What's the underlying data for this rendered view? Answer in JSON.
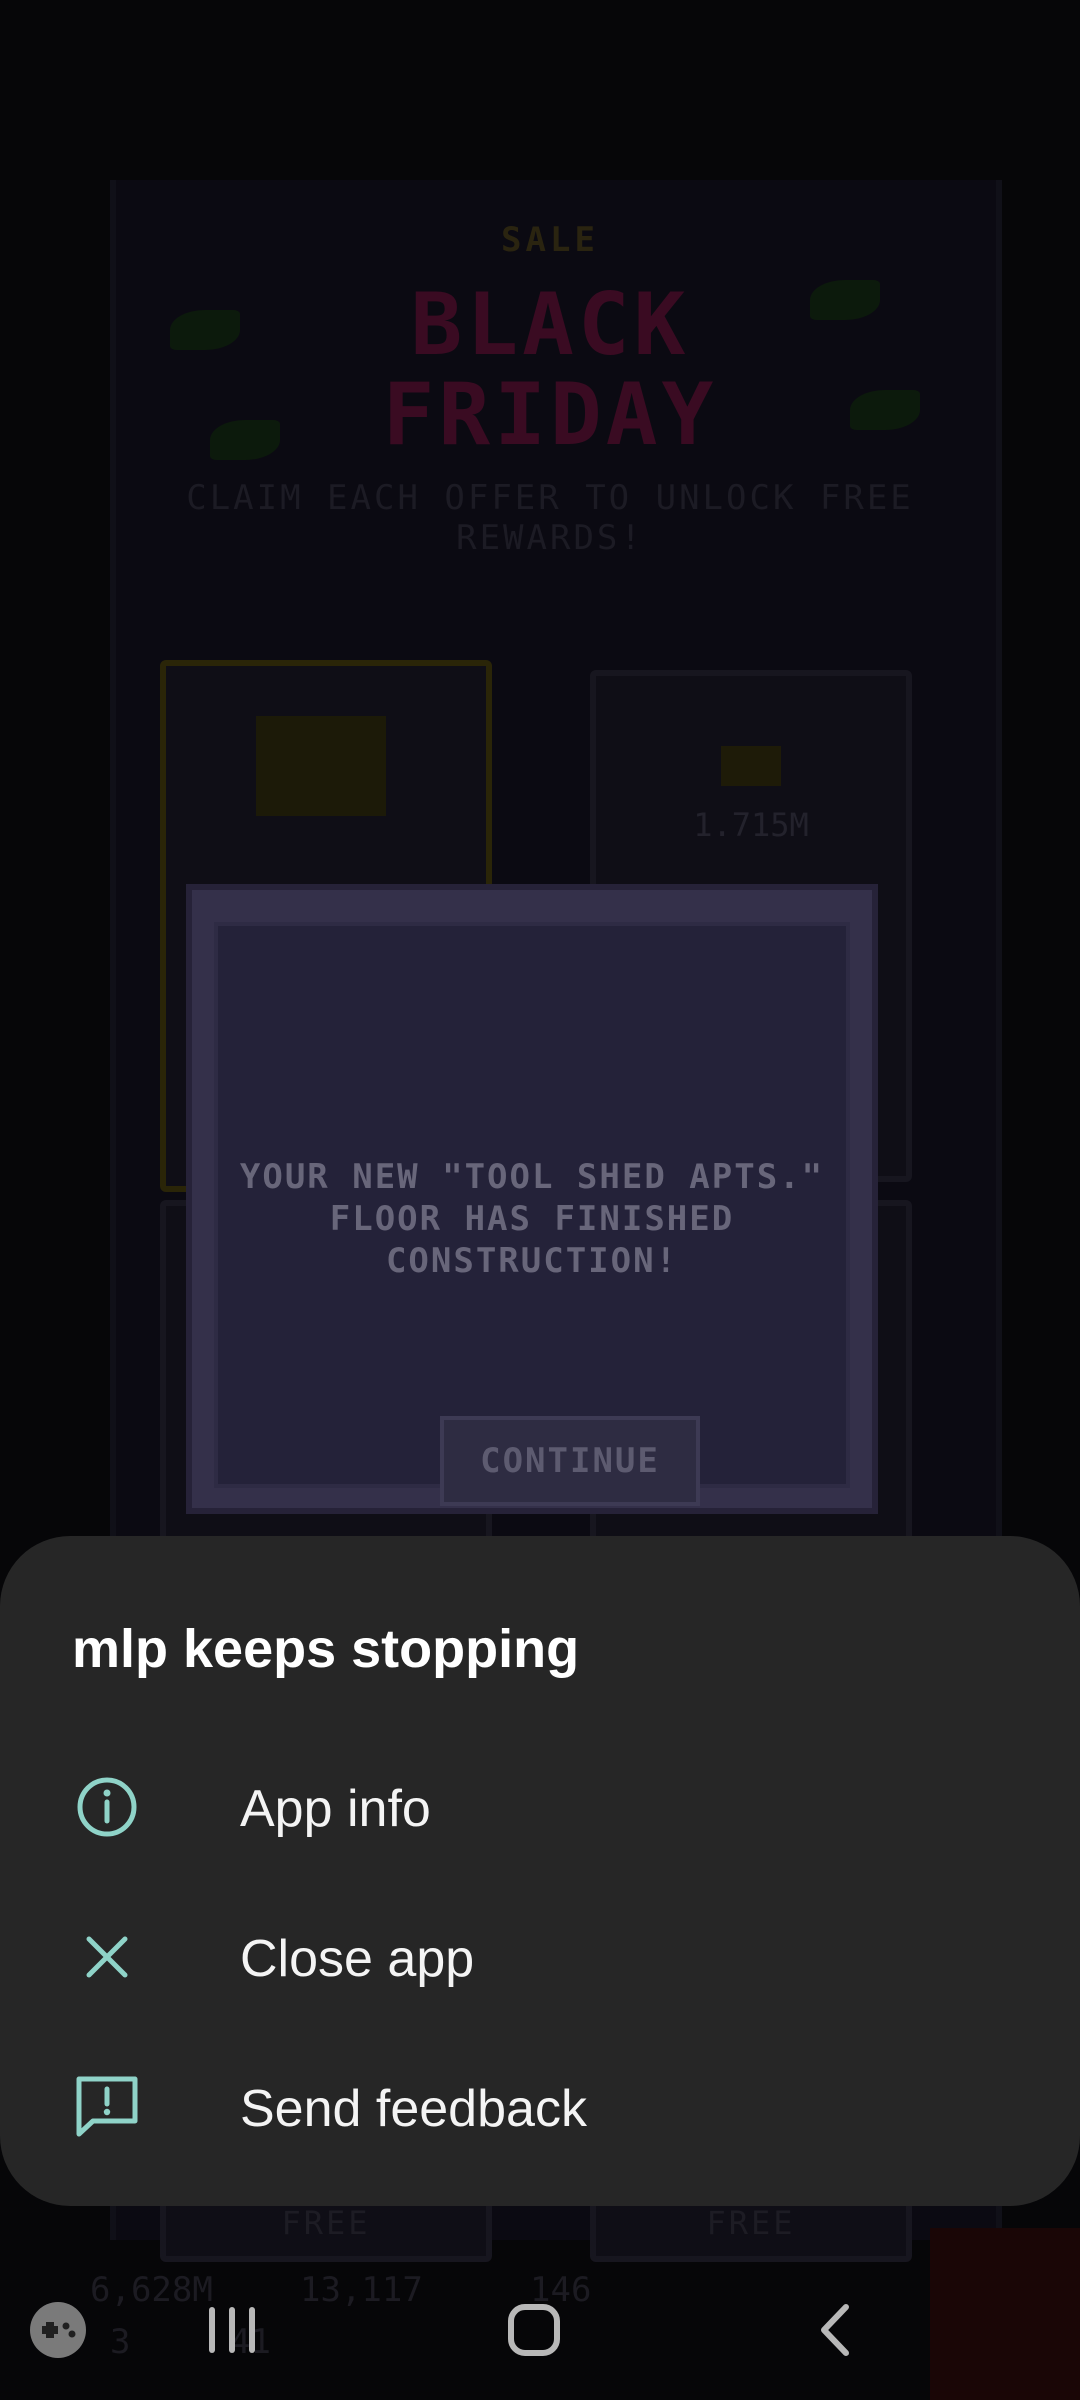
{
  "game_background": {
    "banner_top": "SALE",
    "banner_line1": "BLACK",
    "banner_line2": "FRIDAY",
    "claim_text": "CLAIM EACH OFFER TO UNLOCK FREE REWARDS!",
    "card_value": "1.715M",
    "card_free_label": "FREE",
    "hud": {
      "coins": "6,628M",
      "bux": "13,117",
      "tickets": "146",
      "level": "3",
      "floors": "41"
    }
  },
  "game_modal": {
    "message": "YOUR NEW \"TOOL SHED APTS.\" FLOOR HAS FINISHED CONSTRUCTION!",
    "continue_label": "CONTINUE"
  },
  "dialog": {
    "title": "mlp keeps stopping",
    "options": [
      {
        "label": "App info",
        "icon": "info-icon"
      },
      {
        "label": "Close app",
        "icon": "close-icon"
      },
      {
        "label": "Send feedback",
        "icon": "feedback-icon"
      }
    ],
    "accent_color": "#8fd3c8",
    "background_color": "#262626"
  },
  "navbar": {
    "game_tools_icon": "game-tools-icon",
    "recent_apps_icon": "recent-apps-icon",
    "home_icon": "home-icon",
    "back_icon": "back-icon"
  }
}
